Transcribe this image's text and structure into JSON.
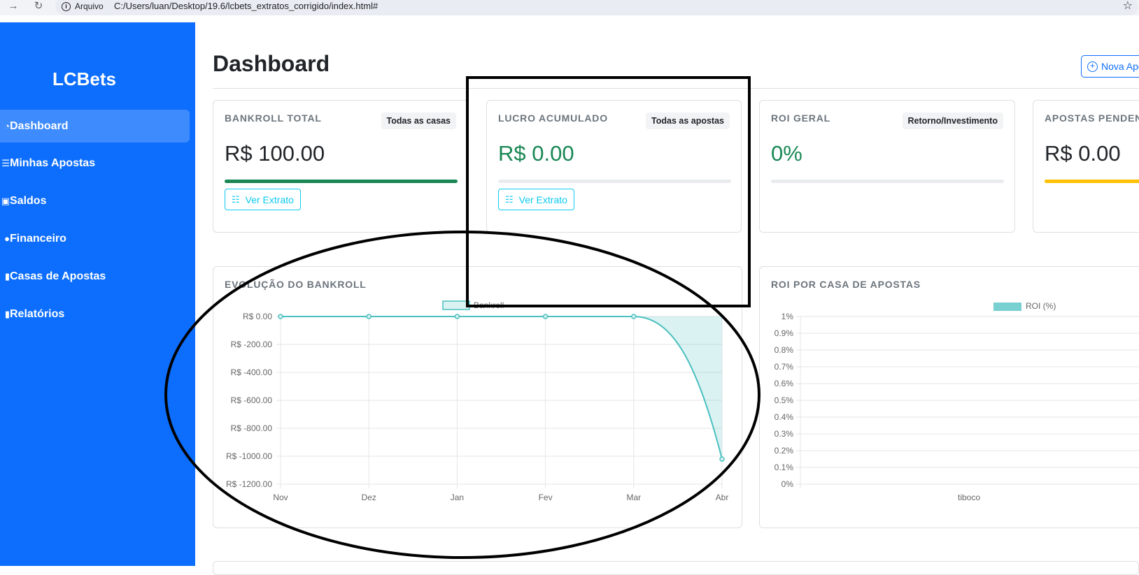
{
  "browser": {
    "back_icon": "→",
    "reload_icon": "↻",
    "info_label": "Arquivo",
    "url": "C:/Users/luan/Desktop/19.6/lcbets_extratos_corrigido/index.html#",
    "star_icon": "☆"
  },
  "sidebar": {
    "brand": "LCBets",
    "items": [
      {
        "label": "Dashboard",
        "icon": "speedometer-icon"
      },
      {
        "label": "Minhas Apostas",
        "icon": "list-icon"
      },
      {
        "label": "Saldos",
        "icon": "wallet-icon"
      },
      {
        "label": "Financeiro",
        "icon": "cash-icon"
      },
      {
        "label": "Casas de Apostas",
        "icon": "building-icon"
      },
      {
        "label": "Relatórios",
        "icon": "graph-icon"
      }
    ]
  },
  "header": {
    "title": "Dashboard",
    "new_button": "Nova Apo"
  },
  "cards": [
    {
      "label": "BANKROLL TOTAL",
      "badge": "Todas as casas",
      "value": "R$ 100.00",
      "value_color": "#212529",
      "bar_color": "#198754",
      "bar_level": 1.0,
      "button": "Ver Extrato"
    },
    {
      "label": "LUCRO ACUMULADO",
      "badge": "Todas as apostas",
      "value": "R$ 0.00",
      "value_color": "#198754",
      "bar_color": "#e9ecef",
      "bar_level": 0,
      "button": "Ver Extrato"
    },
    {
      "label": "ROI GERAL",
      "badge": "Retorno/Investimento",
      "value": "0%",
      "value_color": "#198754",
      "bar_color": "#e9ecef",
      "bar_level": 0
    },
    {
      "label": "APOSTAS PENDENT",
      "value": "R$ 0.00",
      "value_color": "#212529",
      "bar_color": "#ffc107",
      "bar_level": 1.0
    }
  ],
  "chart_data": [
    {
      "type": "area",
      "title": "EVOLUÇÃO DO BANKROLL",
      "series": [
        {
          "name": "Bankroll",
          "values": [
            0,
            0,
            0,
            0,
            0,
            -1020
          ]
        }
      ],
      "categories": [
        "Nov",
        "Dez",
        "Jan",
        "Fev",
        "Mar",
        "Abr"
      ],
      "yticks": [
        "R$ 0.00",
        "R$ -200.00",
        "R$ -400.00",
        "R$ -600.00",
        "R$ -800.00",
        "R$ -1000.00",
        "R$ -1200.00"
      ],
      "ylim": [
        -1200,
        0
      ],
      "color": "#4bc0c0",
      "grid": true,
      "legend": "top-center"
    },
    {
      "type": "bar",
      "title": "ROI POR CASA DE APOSTAS",
      "series": [
        {
          "name": "ROI (%)",
          "values": [
            0
          ]
        }
      ],
      "categories": [
        "tiboco"
      ],
      "yticks": [
        "1%",
        "0.9%",
        "0.8%",
        "0.7%",
        "0.6%",
        "0.5%",
        "0.4%",
        "0.3%",
        "0.2%",
        "0.1%",
        "0%"
      ],
      "ylim": [
        0,
        1
      ],
      "color": "#4bc0c0",
      "grid": true,
      "legend": "top-center"
    }
  ]
}
